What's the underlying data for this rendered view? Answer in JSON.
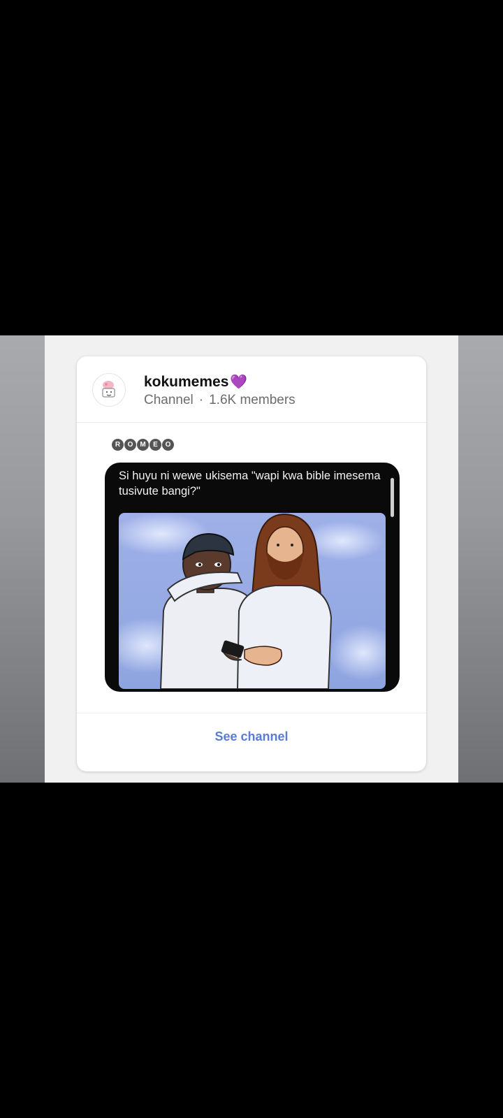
{
  "channel": {
    "name": "kokumemes",
    "heart": "💜",
    "type": "Channel",
    "separator": "·",
    "members": "1.6K members"
  },
  "post": {
    "stamp_letters": [
      "R",
      "O",
      "M",
      "E",
      "O"
    ],
    "caption": "Si huyu ni wewe ukisema \"wapi kwa bible imesema tusivute bangi?\""
  },
  "footer": {
    "see_channel_label": "See channel"
  },
  "colors": {
    "accent": "#5a7bd6",
    "heart": "#9b4fd9"
  }
}
